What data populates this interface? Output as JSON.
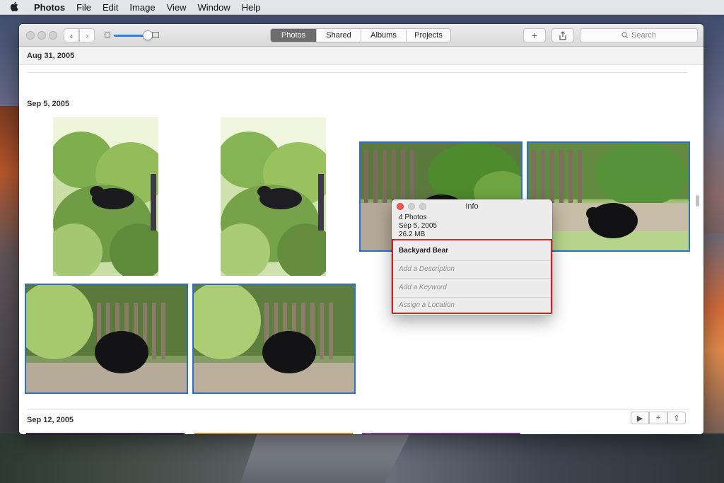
{
  "menubar": {
    "apple": "",
    "items": [
      "Photos",
      "File",
      "Edit",
      "Image",
      "View",
      "Window",
      "Help"
    ]
  },
  "toolbar": {
    "back": "‹",
    "forward": "›",
    "tabs": [
      {
        "label": "Photos",
        "active": true
      },
      {
        "label": "Shared",
        "active": false
      },
      {
        "label": "Albums",
        "active": false
      },
      {
        "label": "Projects",
        "active": false
      }
    ],
    "add": "+",
    "share": "⇪",
    "search_placeholder": "Search",
    "zoom_level": 0.78
  },
  "sections": [
    {
      "date": "Aug 31, 2005"
    },
    {
      "date": "Sep 5, 2005"
    },
    {
      "date": "Sep 12, 2005",
      "actions": [
        "▶",
        "+",
        "⇪"
      ]
    }
  ],
  "info_panel": {
    "title": "Info",
    "count": "4 Photos",
    "date": "Sep 5, 2005",
    "size": "26.2 MB",
    "photo_title": "Backyard Bear",
    "description_placeholder": "Add a Description",
    "keyword_placeholder": "Add a Keyword",
    "location_placeholder": "Assign a Location"
  },
  "colors": {
    "selection": "#2a6fd6",
    "highlight": "#d02020",
    "close": "#ee5b51",
    "active_tab": "#6d6d6d"
  },
  "icons": {
    "search": "search-icon",
    "heart": "heart-icon",
    "play": "play-icon",
    "add": "plus-icon",
    "share": "share-icon"
  }
}
